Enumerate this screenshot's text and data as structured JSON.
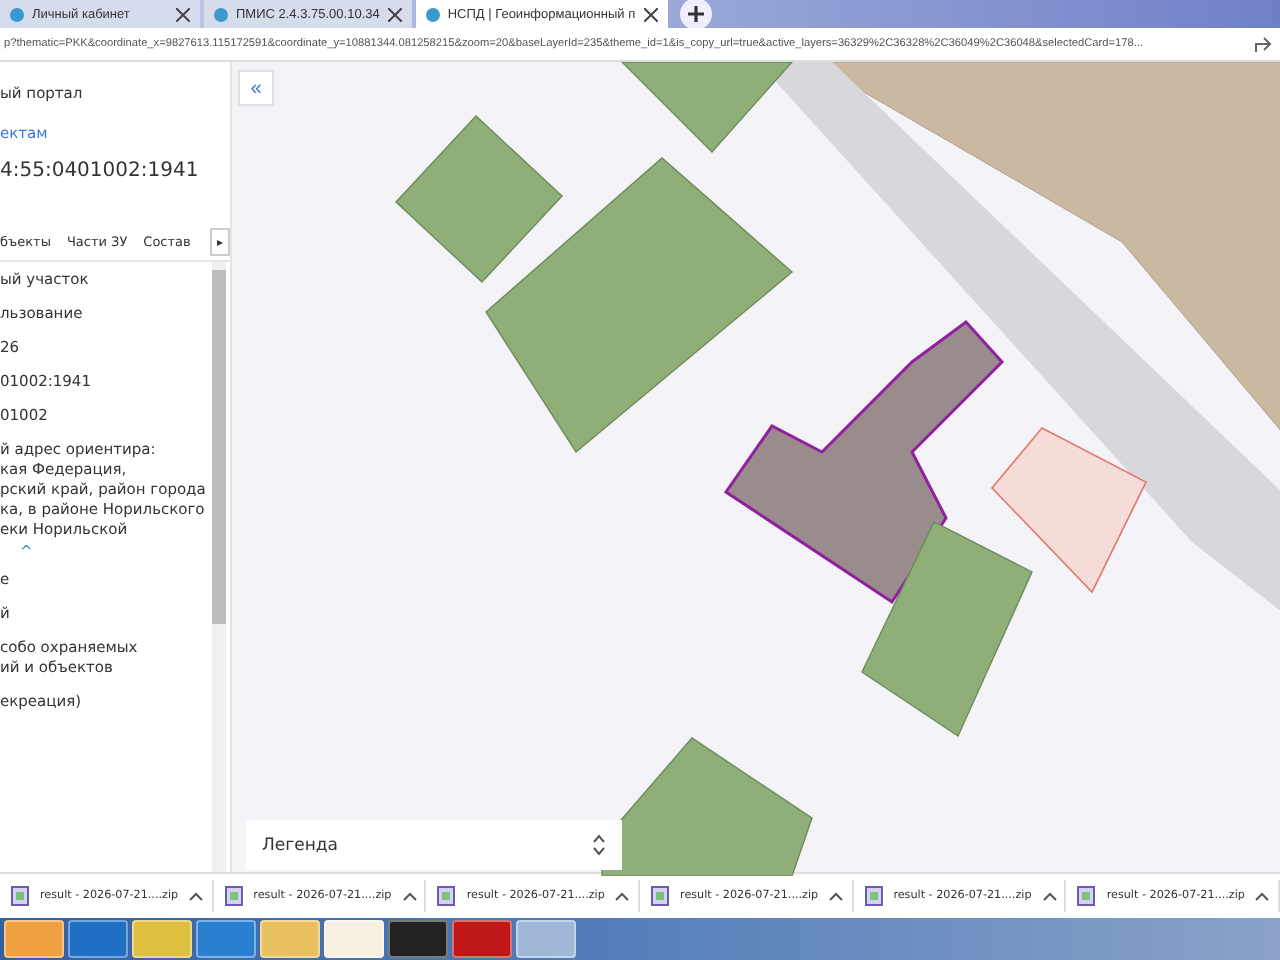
{
  "browser": {
    "tabs": [
      {
        "title": "Личный кабинет",
        "selected": false
      },
      {
        "title": "ПМИС 2.4.3.75.00.10.34",
        "selected": false
      },
      {
        "title": "НСПД | Геоинформационный п",
        "selected": true
      }
    ],
    "address": "p?thematic=PKK&coordinate_x=9827613.115172591&coordinate_y=10881344.081258215&zoom=20&baseLayerId=235&theme_id=1&is_copy_url=true&active_layers=36329%2C36328%2C36049%2C36048&selectedCard=178..."
  },
  "panel": {
    "portal": "ый портал",
    "link": "ектам",
    "cadastral_number": "4:55:0401002:1941",
    "tabs": [
      {
        "label": "бъекты",
        "selected": false
      },
      {
        "label": "Части ЗУ",
        "selected": false
      },
      {
        "label": "Состав",
        "selected": false
      }
    ],
    "tabs_more": "▸",
    "items": [
      {
        "lines": [
          "ый участок"
        ]
      },
      {
        "lines": [
          "льзование"
        ]
      },
      {
        "lines": [
          "26"
        ]
      },
      {
        "lines": [
          "01002:1941"
        ]
      },
      {
        "lines": [
          "01002"
        ]
      },
      {
        "lines": [
          "й адрес ориентира:",
          "кая Федерация,",
          "рский край, район города",
          "ка, в районе Норильского",
          "еки Норильской"
        ]
      },
      {
        "lines": [
          "^"
        ],
        "kind": "toggle"
      },
      {
        "lines": [
          "е"
        ]
      },
      {
        "lines": [
          "й"
        ]
      },
      {
        "lines": [
          "собо охраняемых",
          "ий и объектов"
        ]
      },
      {
        "lines": [
          "екреация)"
        ]
      }
    ]
  },
  "map": {
    "collapse": "«",
    "legend": "Легенда"
  },
  "downloads": [
    {
      "name": "result - 2026-07-21....zip"
    },
    {
      "name": "result - 2026-07-21....zip"
    },
    {
      "name": "result - 2026-07-21....zip"
    },
    {
      "name": "result - 2026-07-21....zip"
    },
    {
      "name": "result - 2026-07-21....zip"
    },
    {
      "name": "result - 2026-07-21....zip"
    }
  ],
  "taskbar": [
    {
      "kind": "media"
    },
    {
      "kind": "mail"
    },
    {
      "kind": "chrome"
    },
    {
      "kind": "sync"
    },
    {
      "kind": "folder"
    },
    {
      "kind": "yandex"
    },
    {
      "kind": "archive"
    },
    {
      "kind": "pdf"
    },
    {
      "kind": "tool"
    }
  ]
}
